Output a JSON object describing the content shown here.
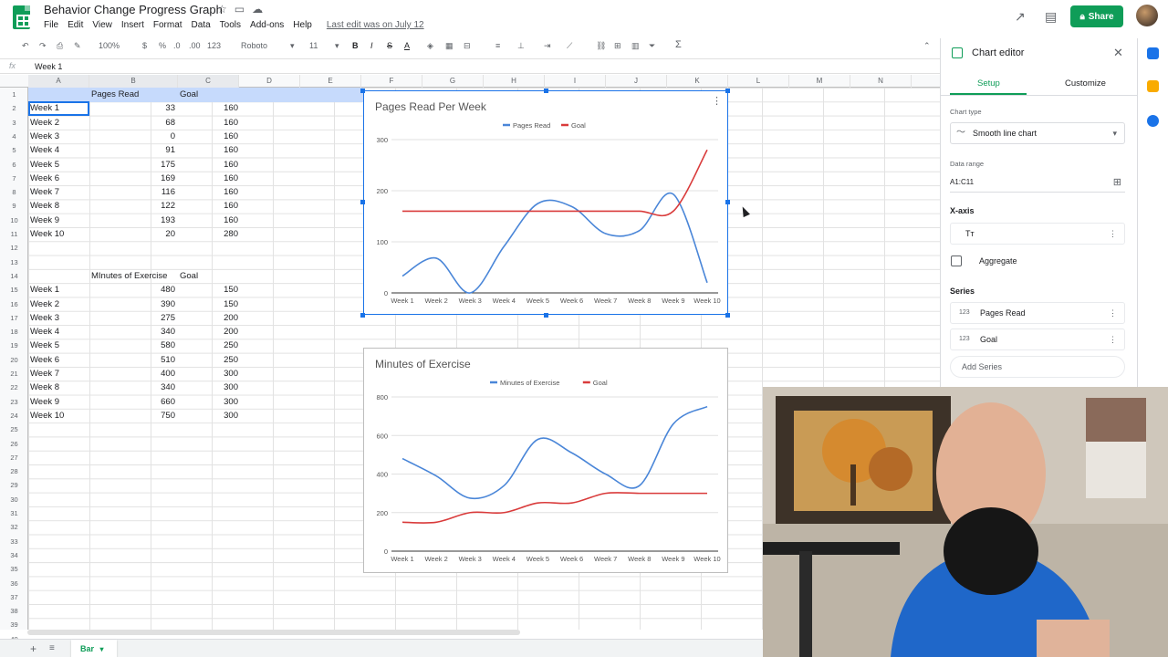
{
  "app": {
    "title": "Behavior Change Progress Graph",
    "menu": [
      "File",
      "Edit",
      "View",
      "Insert",
      "Format",
      "Data",
      "Tools",
      "Add-ons",
      "Help"
    ],
    "last_edit": "Last edit was on July 12",
    "share_label": "Share"
  },
  "toolbar": {
    "zoom": "100%",
    "currency": "$",
    "percent": "%",
    "decimal_dec": ".0",
    "decimal_inc": ".00",
    "more_formats": "123",
    "font": "Roboto",
    "font_size": "11",
    "bold": "B",
    "italic": "I",
    "strike": "S",
    "text_color": "A",
    "sum": "Σ"
  },
  "formula_bar": {
    "fx": "fx",
    "value": "Week 1"
  },
  "columns": [
    "A",
    "B",
    "C",
    "D",
    "E",
    "F",
    "G",
    "H",
    "I",
    "J",
    "K",
    "L",
    "M",
    "N"
  ],
  "rows": [
    "1",
    "2",
    "3",
    "4",
    "5",
    "6",
    "7",
    "8",
    "9",
    "10",
    "11",
    "12",
    "13",
    "14",
    "15",
    "16",
    "17",
    "18",
    "19",
    "20",
    "21",
    "22",
    "23",
    "24",
    "25",
    "26",
    "27",
    "28",
    "29",
    "30",
    "31",
    "32",
    "33",
    "34",
    "35",
    "36",
    "37",
    "38",
    "39",
    "40"
  ],
  "table1": {
    "header_b": "Pages Read",
    "header_c": "Goal",
    "rows": [
      {
        "a": "Week 1",
        "b": "33",
        "c": "160"
      },
      {
        "a": "Week 2",
        "b": "68",
        "c": "160"
      },
      {
        "a": "Week 3",
        "b": "0",
        "c": "160"
      },
      {
        "a": "Week 4",
        "b": "91",
        "c": "160"
      },
      {
        "a": "Week 5",
        "b": "175",
        "c": "160"
      },
      {
        "a": "Week 6",
        "b": "169",
        "c": "160"
      },
      {
        "a": "Week 7",
        "b": "116",
        "c": "160"
      },
      {
        "a": "Week 8",
        "b": "122",
        "c": "160"
      },
      {
        "a": "Week 9",
        "b": "193",
        "c": "160"
      },
      {
        "a": "Week 10",
        "b": "20",
        "c": "280"
      }
    ]
  },
  "table2": {
    "header_b": "MInutes of Exercise",
    "header_c": "Goal",
    "rows": [
      {
        "a": "Week 1",
        "b": "480",
        "c": "150"
      },
      {
        "a": "Week 2",
        "b": "390",
        "c": "150"
      },
      {
        "a": "Week 3",
        "b": "275",
        "c": "200"
      },
      {
        "a": "Week 4",
        "b": "340",
        "c": "200"
      },
      {
        "a": "Week 5",
        "b": "580",
        "c": "250"
      },
      {
        "a": "Week 6",
        "b": "510",
        "c": "250"
      },
      {
        "a": "Week 7",
        "b": "400",
        "c": "300"
      },
      {
        "a": "Week 8",
        "b": "340",
        "c": "300"
      },
      {
        "a": "Week 9",
        "b": "660",
        "c": "300"
      },
      {
        "a": "Week 10",
        "b": "750",
        "c": "300"
      }
    ]
  },
  "chart_data": [
    {
      "type": "line",
      "title": "Pages Read Per Week",
      "categories": [
        "Week 1",
        "Week 2",
        "Week 3",
        "Week 4",
        "Week 5",
        "Week 6",
        "Week 7",
        "Week 8",
        "Week 9",
        "Week 10"
      ],
      "series": [
        {
          "name": "Pages Read",
          "color": "#4a86d8",
          "values": [
            33,
            68,
            0,
            91,
            175,
            169,
            116,
            122,
            193,
            20
          ]
        },
        {
          "name": "Goal",
          "color": "#d93b3b",
          "values": [
            160,
            160,
            160,
            160,
            160,
            160,
            160,
            160,
            160,
            280
          ]
        }
      ],
      "yticks": [
        "0",
        "100",
        "200",
        "300"
      ],
      "ylim": [
        0,
        300
      ],
      "legend": "top"
    },
    {
      "type": "line",
      "title": "Minutes of Exercise",
      "categories": [
        "Week 1",
        "Week 2",
        "Week 3",
        "Week 4",
        "Week 5",
        "Week 6",
        "Week 7",
        "Week 8",
        "Week 9",
        "Week 10"
      ],
      "series": [
        {
          "name": "Minutes of Exercise",
          "color": "#4a86d8",
          "values": [
            480,
            390,
            275,
            340,
            580,
            510,
            400,
            340,
            660,
            750
          ]
        },
        {
          "name": "Goal",
          "color": "#d93b3b",
          "values": [
            150,
            150,
            200,
            200,
            250,
            250,
            300,
            300,
            300,
            300
          ]
        }
      ],
      "yticks": [
        "0",
        "200",
        "400",
        "600",
        "800"
      ],
      "ylim": [
        0,
        800
      ],
      "legend": "top"
    }
  ],
  "chart_editor": {
    "title": "Chart editor",
    "tabs": [
      "Setup",
      "Customize"
    ],
    "chart_type_label": "Chart type",
    "chart_type_value": "Smooth line chart",
    "data_range_label": "Data range",
    "data_range_value": "A1:C11",
    "xaxis_heading": "X-axis",
    "xaxis_value": "Tт",
    "aggregate_label": "Aggregate",
    "series_heading": "Series",
    "series": [
      "Pages Read",
      "Goal"
    ],
    "series_icon": "123",
    "add_series": "Add Series"
  },
  "bottom": {
    "sheet_tab": "Bar",
    "add_sheet": "+",
    "all_sheets": "≡"
  },
  "colors": {
    "brand": "#0f9d58",
    "selection": "#1a73e8",
    "series_blue": "#4a86d8",
    "series_red": "#d93b3b"
  }
}
